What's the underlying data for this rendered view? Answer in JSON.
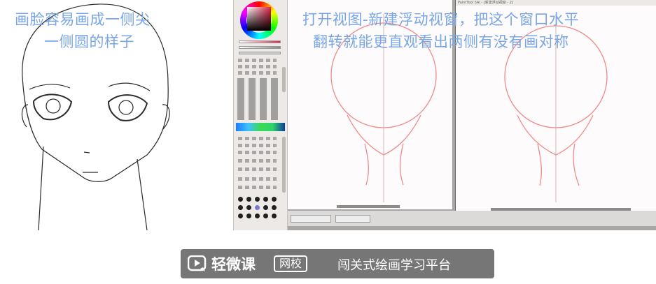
{
  "captions": {
    "left_line1": "画脸容易画成一侧尖",
    "left_line2": "一侧圆的样子",
    "right_line1": "打开视图-新建浮动视窗，把这个窗口水平",
    "right_line2": "翻转就能更直观看出两侧有没有画对称"
  },
  "watermark": {
    "brand": "轻微课",
    "badge": "网校",
    "slogan": "闯关式绘画学习平台"
  },
  "windows": {
    "left_title": "",
    "right_title": "PaintTool SAI - [新建浮动视窗 - 2]"
  },
  "colors": {
    "caption_text": "#7aa6e6",
    "sketch_line": "#f08a8a",
    "watermark_bg": "#5f5f5f"
  },
  "icons": {
    "logo": "play-chat-logo-icon"
  }
}
